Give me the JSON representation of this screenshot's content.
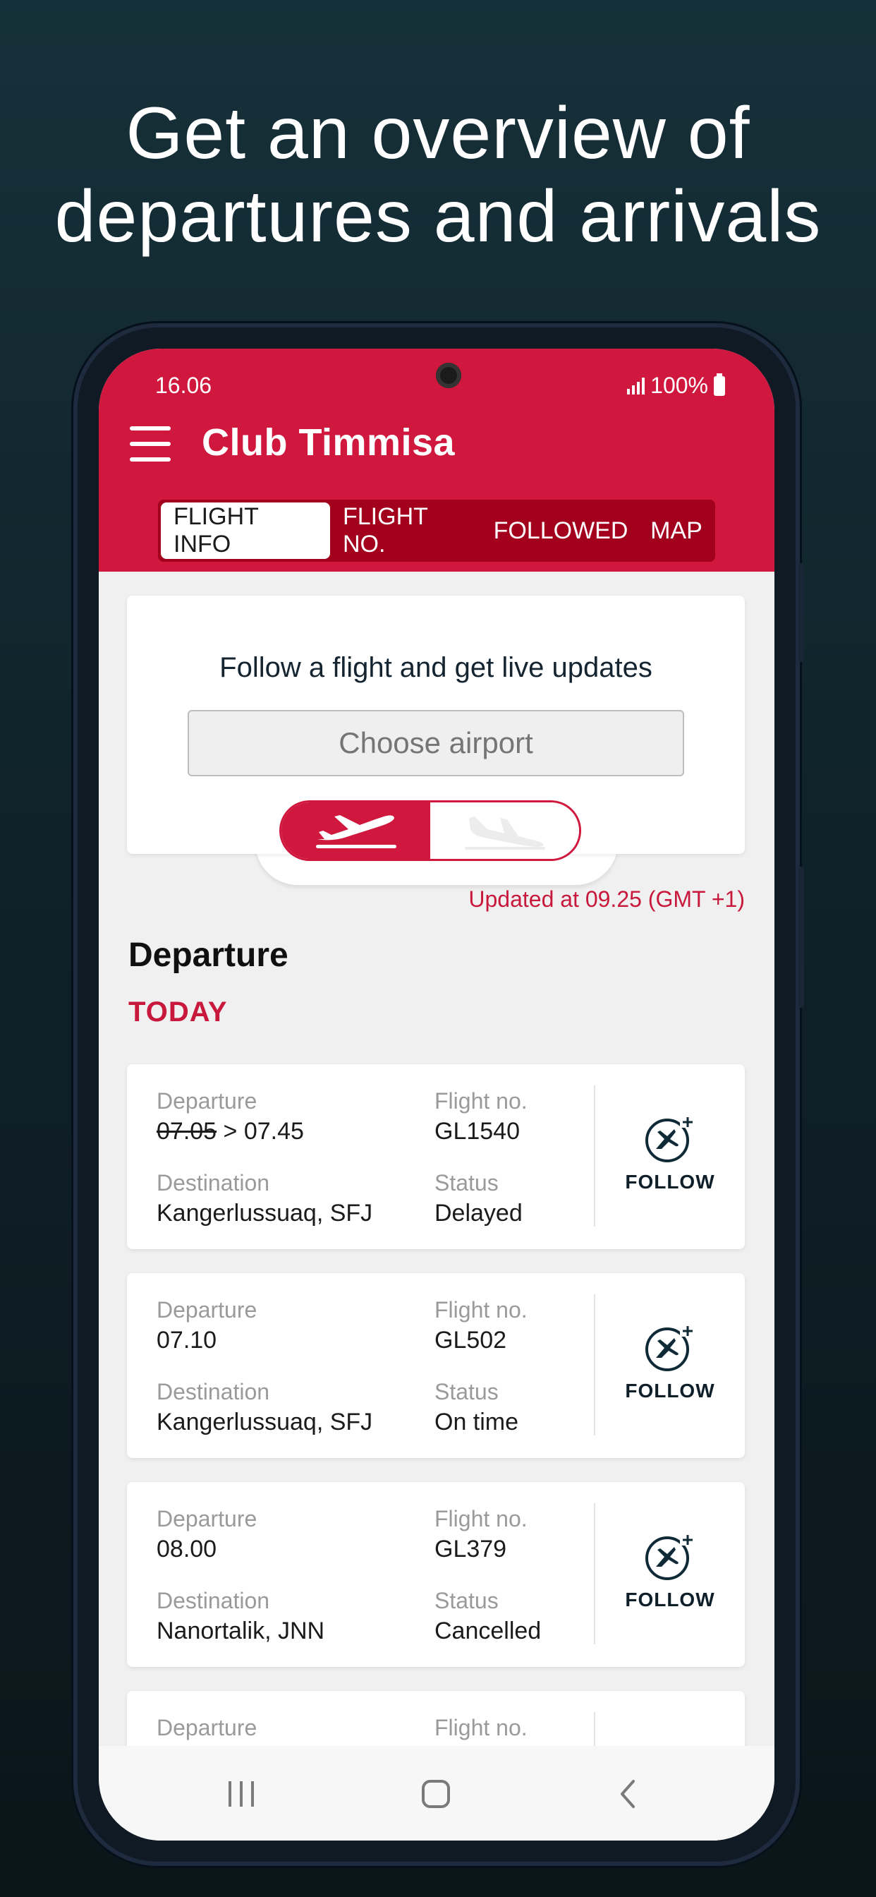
{
  "headline": {
    "line1": "Get an overview of",
    "line2": "departures and arrivals"
  },
  "status_bar": {
    "time": "16.06",
    "battery": "100%"
  },
  "header": {
    "title": "Club Timmisa"
  },
  "tabs": [
    {
      "label": "FLIGHT INFO",
      "active": true
    },
    {
      "label": "FLIGHT NO.",
      "active": false
    },
    {
      "label": "FOLLOWED",
      "active": false
    },
    {
      "label": "MAP",
      "active": false
    }
  ],
  "follow_card": {
    "title": "Follow a flight and get live updates",
    "airport_placeholder": "Choose airport",
    "mode_selected": "departures"
  },
  "updated": "Updated at 09.25 (GMT +1)",
  "section_title": "Departure",
  "day_label": "TODAY",
  "labels": {
    "departure": "Departure",
    "destination": "Destination",
    "flight_no": "Flight no.",
    "status": "Status",
    "follow": "FOLLOW"
  },
  "flights": [
    {
      "departure_old": "07.05",
      "departure_sep": " > ",
      "departure": "07.45",
      "flight_no": "GL1540",
      "destination": "Kangerlussuaq, SFJ",
      "status": "Delayed"
    },
    {
      "departure_old": "",
      "departure_sep": "",
      "departure": "07.10",
      "flight_no": "GL502",
      "destination": "Kangerlussuaq, SFJ",
      "status": "On time"
    },
    {
      "departure_old": "",
      "departure_sep": "",
      "departure": "08.00",
      "flight_no": "GL379",
      "destination": "Nanortalik, JNN",
      "status": "Cancelled"
    }
  ],
  "colors": {
    "brand": "#d0173d",
    "brand_dark": "#a3001d",
    "background": "#0f2229"
  },
  "icons": {
    "menu": "menu-icon",
    "departure": "plane-takeoff-icon",
    "arrival": "plane-landing-icon",
    "follow": "plane-plus-icon",
    "nav_recents": "recents-icon",
    "nav_home": "home-icon",
    "nav_back": "back-icon"
  }
}
